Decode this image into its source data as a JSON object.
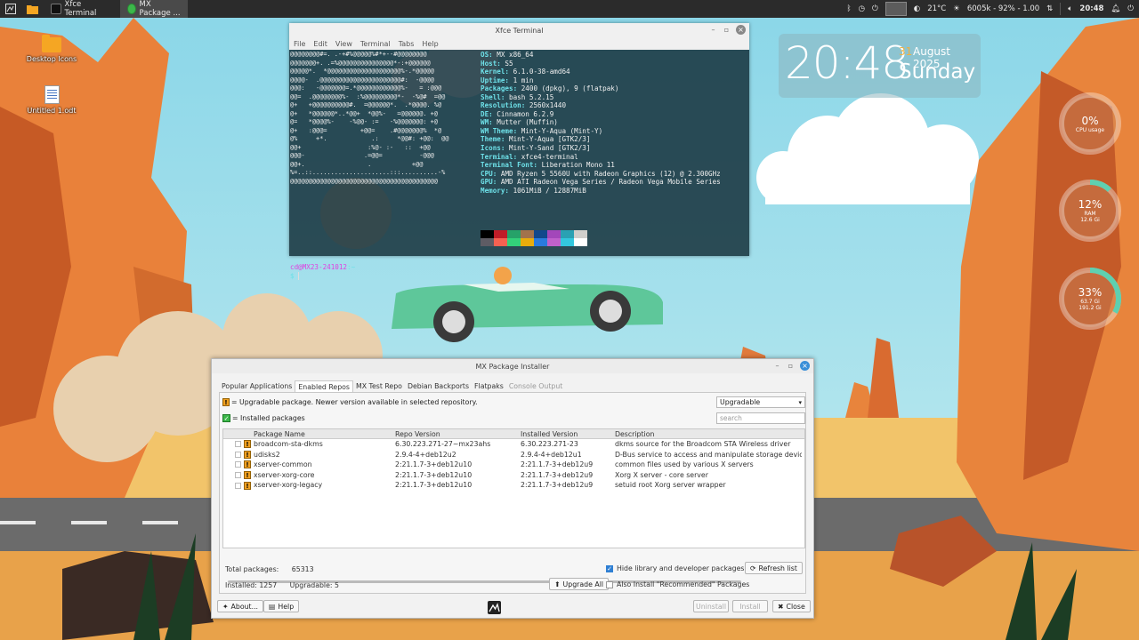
{
  "panel": {
    "tasks": [
      {
        "label": "Xfce Terminal"
      },
      {
        "label": "MX Package ..."
      }
    ],
    "tray": {
      "temperature": "21°C",
      "display": "6005k - 92% - 1.00",
      "clock": "20:48"
    }
  },
  "desktop": {
    "icons": [
      {
        "label": "Desktop Icons"
      },
      {
        "label": "Untitled 1.odt"
      }
    ]
  },
  "conky": {
    "time": "20:48",
    "day": "31",
    "month_year": "August 2025",
    "weekday": "Sunday",
    "cpu": {
      "value": "0%",
      "label": "CPU usage",
      "fraction": 0.0
    },
    "ram": {
      "value": "12%",
      "label": "RAM",
      "detail": "12.6 Gi",
      "fraction": 0.12
    },
    "disk": {
      "value": "33%",
      "detail1": "63.7 Gi",
      "detail2": "191.2 Gi",
      "fraction": 0.33
    }
  },
  "terminal": {
    "title": "Xfce Terminal",
    "menu": [
      "File",
      "Edit",
      "View",
      "Terminal",
      "Tabs",
      "Help"
    ],
    "ascii": "@@@@@@@@#=. .-+#%@@@@@%#*+--#@@@@@@@@\n@@@@@@@+. .=%@@@@@@@@@@@@@@@*-:+@@@@@@\n@@@@@*.  *@@@@@@@@@@@@@@@@@@@@%-.*@@@@@\n@@@@-  .@@@@@@@@@@@@@@@@@@@@@@#:  -@@@@\n@@@:   -@@@@@@@=.*@@@@@@@@@@@@%-   = :@@@\n@@=  .@@@@@@@@%-  :%@@@@@@@@@*-  -%@#  =@@\n@+   +@@@@@@@@@@#.  =@@@@@@*.  .*@@@@. %@\n@+   *@@@@@@*..*@@+  *@@%-   =@@@@@@. +@\n@=   *@@@@%-    -%@@- :=   -%@@@@@@@: +@\n@+   :@@@=         +@@=    .#@@@@@@@%  *@\n@%     +*.            .:     *@@#: +@@:  @@\n@@+                  :%@- :-   ::  +@@\n@@@-                .=@@=          -@@@\n@@+.                 .           +@@\n%=..::.....................:::..........-%\n@@@@@@@@@@@@@@@@@@@@@@@@@@@@@@@@@@@@@@@@",
    "info": [
      {
        "k": "OS",
        "v": "MX x86_64"
      },
      {
        "k": "Host",
        "v": "S5"
      },
      {
        "k": "Kernel",
        "v": "6.1.0-38-amd64"
      },
      {
        "k": "Uptime",
        "v": "1 min"
      },
      {
        "k": "Packages",
        "v": "2400 (dpkg), 9 (flatpak)"
      },
      {
        "k": "Shell",
        "v": "bash 5.2.15"
      },
      {
        "k": "Resolution",
        "v": "2560x1440"
      },
      {
        "k": "DE",
        "v": "Cinnamon 6.2.9"
      },
      {
        "k": "WM",
        "v": "Mutter (Muffin)"
      },
      {
        "k": "WM Theme",
        "v": "Mint-Y-Aqua (Mint-Y)"
      },
      {
        "k": "Theme",
        "v": "Mint-Y-Aqua [GTK2/3]"
      },
      {
        "k": "Icons",
        "v": "Mint-Y-Sand [GTK2/3]"
      },
      {
        "k": "Terminal",
        "v": "xfce4-terminal"
      },
      {
        "k": "Terminal Font",
        "v": "Liberation Mono 11"
      },
      {
        "k": "CPU",
        "v": "AMD Ryzen 5 5560U with Radeon Graphics (12) @ 2.300GHz"
      },
      {
        "k": "GPU",
        "v": "AMD ATI Radeon Vega Series / Radeon Vega Mobile Series"
      },
      {
        "k": "Memory",
        "v": "1061MiB / 12887MiB"
      }
    ],
    "palette": [
      "#000000",
      "#c01c28",
      "#26a269",
      "#a2734c",
      "#12488b",
      "#a347ba",
      "#2aa1b3",
      "#d0cfcc",
      "#5e5c64",
      "#f66151",
      "#33d17a",
      "#e9ad0c",
      "#2a7bde",
      "#c061cb",
      "#33c7de",
      "#ffffff"
    ],
    "prompt_user": "cd@MX23-241012",
    "prompt_path": ":~",
    "prompt_symbol": "$"
  },
  "installer": {
    "title": "MX Package Installer",
    "tabs": [
      {
        "label": "Popular Applications",
        "state": "normal"
      },
      {
        "label": "Enabled Repos",
        "state": "active"
      },
      {
        "label": "MX Test Repo",
        "state": "normal"
      },
      {
        "label": "Debian Backports",
        "state": "normal"
      },
      {
        "label": "Flatpaks",
        "state": "normal"
      },
      {
        "label": "Console Output",
        "state": "disabled"
      }
    ],
    "legend_upgradable": "= Upgradable package. Newer version available in selected repository.",
    "legend_installed": "= Installed packages",
    "filter_selected": "Upgradable",
    "search_placeholder": "search",
    "columns": [
      "Package Name",
      "Repo Version",
      "Installed Version",
      "Description"
    ],
    "rows": [
      {
        "name": "broadcom-sta-dkms",
        "repo": "6.30.223.271-27~mx23ahs",
        "installed": "6.30.223.271-23",
        "desc": "dkms source for the Broadcom STA Wireless driver"
      },
      {
        "name": "udisks2",
        "repo": "2.9.4-4+deb12u2",
        "installed": "2.9.4-4+deb12u1",
        "desc": "D-Bus service to access and manipulate storage devices"
      },
      {
        "name": "xserver-common",
        "repo": "2:21.1.7-3+deb12u10",
        "installed": "2:21.1.7-3+deb12u9",
        "desc": "common files used by various X servers"
      },
      {
        "name": "xserver-xorg-core",
        "repo": "2:21.1.7-3+deb12u10",
        "installed": "2:21.1.7-3+deb12u9",
        "desc": "Xorg X server - core server"
      },
      {
        "name": "xserver-xorg-legacy",
        "repo": "2:21.1.7-3+deb12u10",
        "installed": "2:21.1.7-3+deb12u9",
        "desc": "setuid root Xorg server wrapper"
      }
    ],
    "total_label": "Total packages:",
    "total_value": "65313",
    "installed_label": "Installed: 1257",
    "upgradable_label": "Upgradable: 5",
    "hide_libs_label": "Hide library and developer packages",
    "recommended_label": "Also Install \"Recommended\" Packages",
    "refresh_label": "Refresh list",
    "upgrade_all_label": "Upgrade All",
    "about_label": "About...",
    "help_label": "Help",
    "uninstall_label": "Uninstall",
    "install_label": "Install",
    "close_label": "Close"
  }
}
